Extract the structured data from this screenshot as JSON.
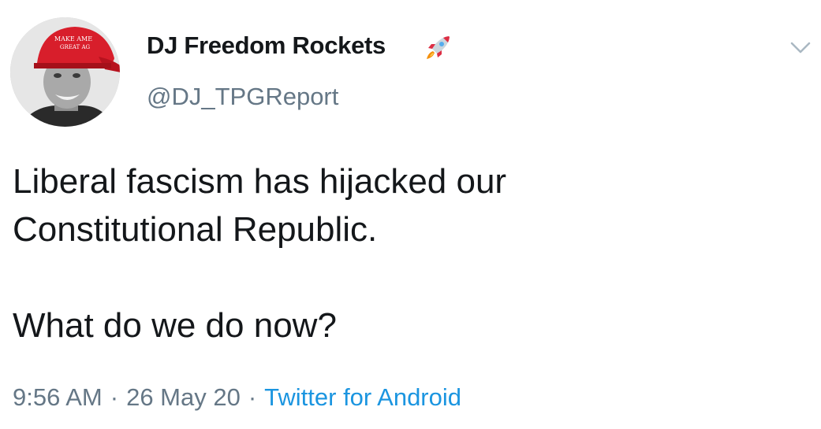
{
  "tweet": {
    "display_name": "DJ Freedom Rockets",
    "handle": "@DJ_TPGReport",
    "text_lines": [
      "Liberal fascism has hijacked our",
      "Constitutional Republic.",
      "What do we do now?"
    ],
    "time": "9:56 AM",
    "date": "26 May 20",
    "separator": "·",
    "source": "Twitter for Android",
    "hat_text": [
      "MAKE AME",
      "GREAT AG"
    ],
    "icons": {
      "name_emoji": "rocket-icon",
      "menu": "chevron-down-icon",
      "avatar": "profile-photo"
    },
    "colors": {
      "text": "#14171a",
      "secondary": "#657786",
      "link": "#1b95e0",
      "hat": "#d81e2b"
    }
  }
}
